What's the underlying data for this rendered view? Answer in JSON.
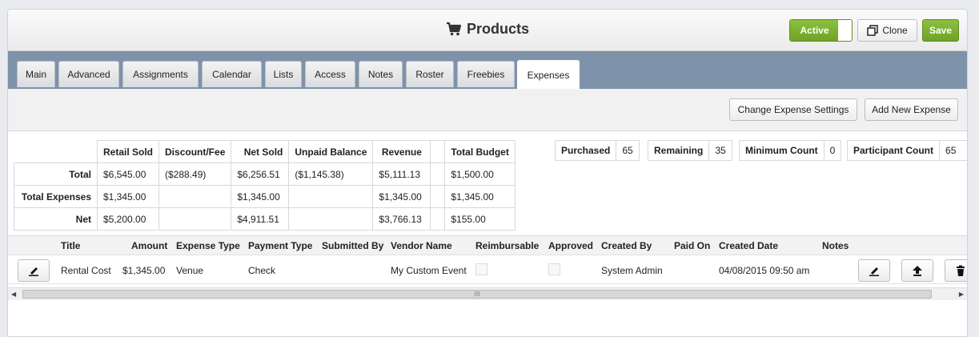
{
  "header": {
    "title": "Products",
    "icon": "cart-icon",
    "status_toggle": "Active",
    "clone_label": "Clone",
    "save_label": "Save",
    "accent_color": "#78ad2f"
  },
  "tabs": [
    {
      "label": "Main"
    },
    {
      "label": "Advanced"
    },
    {
      "label": "Assignments"
    },
    {
      "label": "Calendar"
    },
    {
      "label": "Lists"
    },
    {
      "label": "Access"
    },
    {
      "label": "Notes"
    },
    {
      "label": "Roster"
    },
    {
      "label": "Freebies"
    },
    {
      "label": "Expenses",
      "active": true
    }
  ],
  "toolbar": {
    "settings_label": "Change Expense Settings",
    "new_label": "Add New Expense"
  },
  "summary": {
    "headers": [
      "Retail Sold",
      "Discount/Fee",
      "Net Sold",
      "Unpaid Balance",
      "Revenue",
      "",
      "Total Budget"
    ],
    "rows": [
      {
        "label": "Total",
        "cells": [
          "$6,545.00",
          "($288.49)",
          "$6,256.51",
          "($1,145.38)",
          "$5,111.13",
          "",
          "$1,500.00"
        ]
      },
      {
        "label": "Total Expenses",
        "cells": [
          "$1,345.00",
          "",
          "$1,345.00",
          "",
          "$1,345.00",
          "",
          "$1,345.00"
        ]
      },
      {
        "label": "Net",
        "cells": [
          "$5,200.00",
          "",
          "$4,911.51",
          "",
          "$3,766.13",
          "",
          "$155.00"
        ]
      }
    ]
  },
  "stats": {
    "purchased": {
      "label": "Purchased",
      "value": "65"
    },
    "remaining": {
      "label": "Remaining",
      "value": "35"
    },
    "minimum": {
      "label": "Minimum Count",
      "value": "0"
    },
    "participant": {
      "label": "Participant Count",
      "value": "65"
    }
  },
  "grid": {
    "columns": [
      "Title",
      "Amount",
      "Expense Type",
      "Payment Type",
      "Submitted By",
      "Vendor Name",
      "Reimbursable",
      "Approved",
      "Created By",
      "Paid On",
      "Created Date",
      "Notes"
    ],
    "rows": [
      {
        "title": "Rental Cost",
        "amount": "$1,345.00",
        "expense_type": "Venue",
        "payment_type": "Check",
        "submitted_by": "",
        "vendor_name": "My Custom Event",
        "reimbursable": false,
        "approved": false,
        "created_by": "System Admin",
        "paid_on": "",
        "created_date": "04/08/2015 09:50 am",
        "notes": ""
      }
    ]
  },
  "scrollbar": {
    "grip": "III"
  }
}
